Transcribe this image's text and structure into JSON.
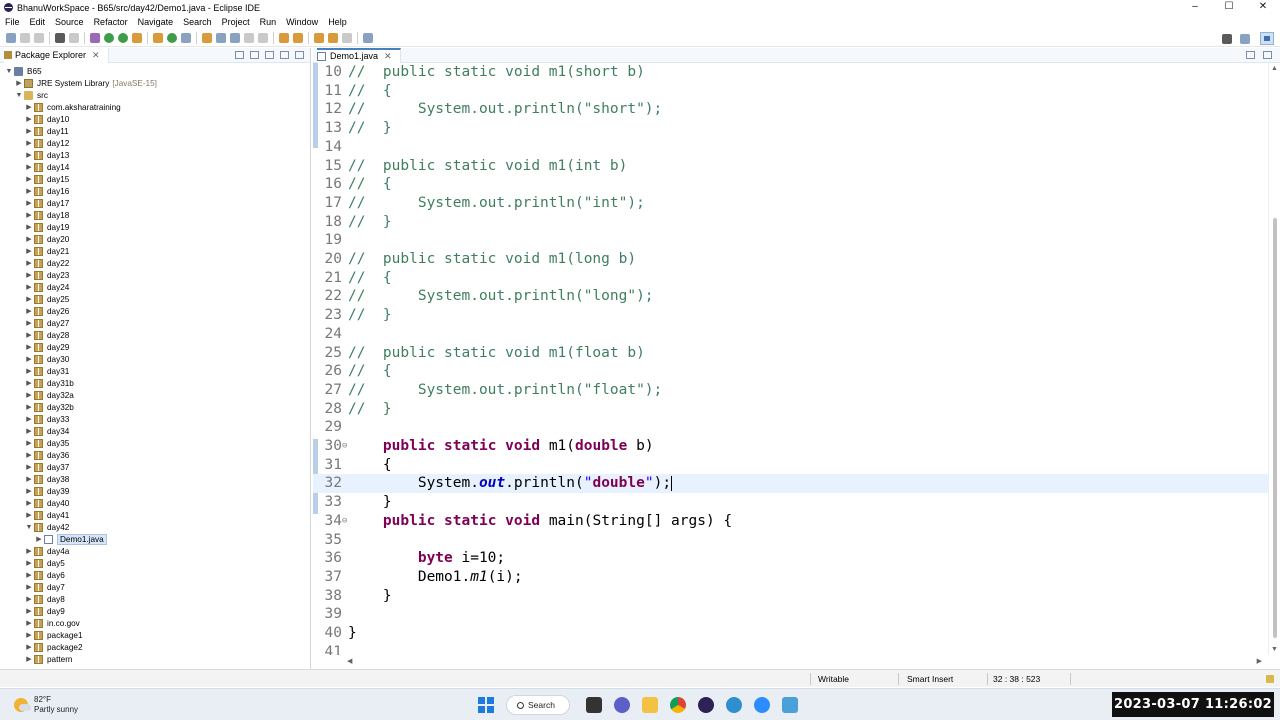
{
  "window": {
    "title": "BhanuWorkSpace - B65/src/day42/Demo1.java - Eclipse IDE",
    "controls": [
      "–",
      "☐",
      "✕"
    ]
  },
  "menu": [
    "File",
    "Edit",
    "Source",
    "Refactor",
    "Navigate",
    "Search",
    "Project",
    "Run",
    "Window",
    "Help"
  ],
  "explorer": {
    "tab_label": "Package Explorer",
    "project": "B65",
    "library": "JRE System Library",
    "library_version": "[JavaSE-15]",
    "src": "src",
    "packages_before": [
      "com.aksharatraining",
      "day10",
      "day11",
      "day12",
      "day13",
      "day14",
      "day15",
      "day16",
      "day17",
      "day18",
      "day19",
      "day20",
      "day21",
      "day22",
      "day23",
      "day24",
      "day25",
      "day26",
      "day27",
      "day28",
      "day29",
      "day30",
      "day31",
      "day31b",
      "day32a",
      "day32b",
      "day33",
      "day34",
      "day35",
      "day36",
      "day37",
      "day38",
      "day39",
      "day40",
      "day41"
    ],
    "open_package": "day42",
    "open_file": "Demo1.java",
    "packages_after": [
      "day4a",
      "day5",
      "day6",
      "day7",
      "day8",
      "day9",
      "in.co.gov",
      "package1",
      "package2",
      "pattern"
    ]
  },
  "editor": {
    "tab_label": "Demo1.java",
    "current_line": "32",
    "lines": [
      {
        "n": "10",
        "c": "//  public static void m1(short b)"
      },
      {
        "n": "11",
        "c": "//  {"
      },
      {
        "n": "12",
        "c": "//      System.out.println(\"short\");"
      },
      {
        "n": "13",
        "c": "//  }"
      },
      {
        "n": "14",
        "c": ""
      },
      {
        "n": "15",
        "c": "//  public static void m1(int b)"
      },
      {
        "n": "16",
        "c": "//  {"
      },
      {
        "n": "17",
        "c": "//      System.out.println(\"int\");"
      },
      {
        "n": "18",
        "c": "//  }"
      },
      {
        "n": "19",
        "c": ""
      },
      {
        "n": "20",
        "c": "//  public static void m1(long b)"
      },
      {
        "n": "21",
        "c": "//  {"
      },
      {
        "n": "22",
        "c": "//      System.out.println(\"long\");"
      },
      {
        "n": "23",
        "c": "//  }"
      },
      {
        "n": "24",
        "c": ""
      },
      {
        "n": "25",
        "c": "//  public static void m1(float b)"
      },
      {
        "n": "26",
        "c": "//  {"
      },
      {
        "n": "27",
        "c": "//      System.out.println(\"float\");"
      },
      {
        "n": "28",
        "c": "//  }"
      },
      {
        "n": "29",
        "c": ""
      },
      {
        "n": "30",
        "c": "    public static void m1(double b)"
      },
      {
        "n": "31",
        "c": "    {"
      },
      {
        "n": "32",
        "c": "        System.out.println(\"double\");"
      },
      {
        "n": "33",
        "c": "    }"
      },
      {
        "n": "34",
        "c": "    public static void main(String[] args) {"
      },
      {
        "n": "35",
        "c": ""
      },
      {
        "n": "36",
        "c": "        byte i=10;"
      },
      {
        "n": "37",
        "c": "        Demo1.m1(i);"
      },
      {
        "n": "38",
        "c": "    }"
      },
      {
        "n": "39",
        "c": ""
      },
      {
        "n": "40",
        "c": "}"
      },
      {
        "n": "41",
        "c": ""
      }
    ]
  },
  "status": {
    "writable": "Writable",
    "insert_mode": "Smart Insert",
    "position": "32 : 38 : 523"
  },
  "taskbar": {
    "temperature": "82°F",
    "weather": "Partly sunny",
    "search_label": "Search",
    "clock": "2023-03-07  11:26:02"
  },
  "icons": {
    "title": "eclipse-icon",
    "explorer": "package-explorer-icon"
  },
  "colors": {
    "keyword": "#7f0055",
    "comment": "#3f7f5f",
    "string": "#2a00ff",
    "field": "#0000c0",
    "current_line_bg": "#e8f2fe"
  }
}
